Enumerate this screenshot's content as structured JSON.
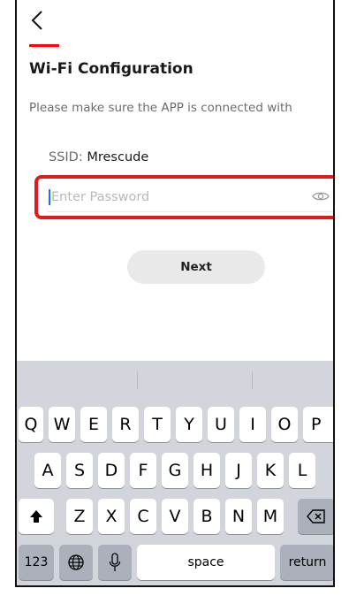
{
  "header": {
    "title": "Wi-Fi Configuration",
    "accent_color": "#ff000f"
  },
  "content": {
    "description": "Please make sure the APP is connected with",
    "ssid_label": "SSID: ",
    "ssid_value": "Mrescude",
    "password_placeholder": "Enter Password",
    "password_value": "",
    "next_label": "Next"
  },
  "keyboard": {
    "row1": [
      "Q",
      "W",
      "E",
      "R",
      "T",
      "Y",
      "U",
      "I",
      "O",
      "P"
    ],
    "row2": [
      "A",
      "S",
      "D",
      "F",
      "G",
      "H",
      "J",
      "K",
      "L"
    ],
    "row3": [
      "Z",
      "X",
      "C",
      "V",
      "B",
      "N",
      "M"
    ],
    "numbers_label": "123",
    "space_label": "space",
    "return_label": "return"
  },
  "colors": {
    "highlight_border": "#e01a1a",
    "caret": "#1e6fff",
    "keyboard_bg": "#d2d5db"
  }
}
